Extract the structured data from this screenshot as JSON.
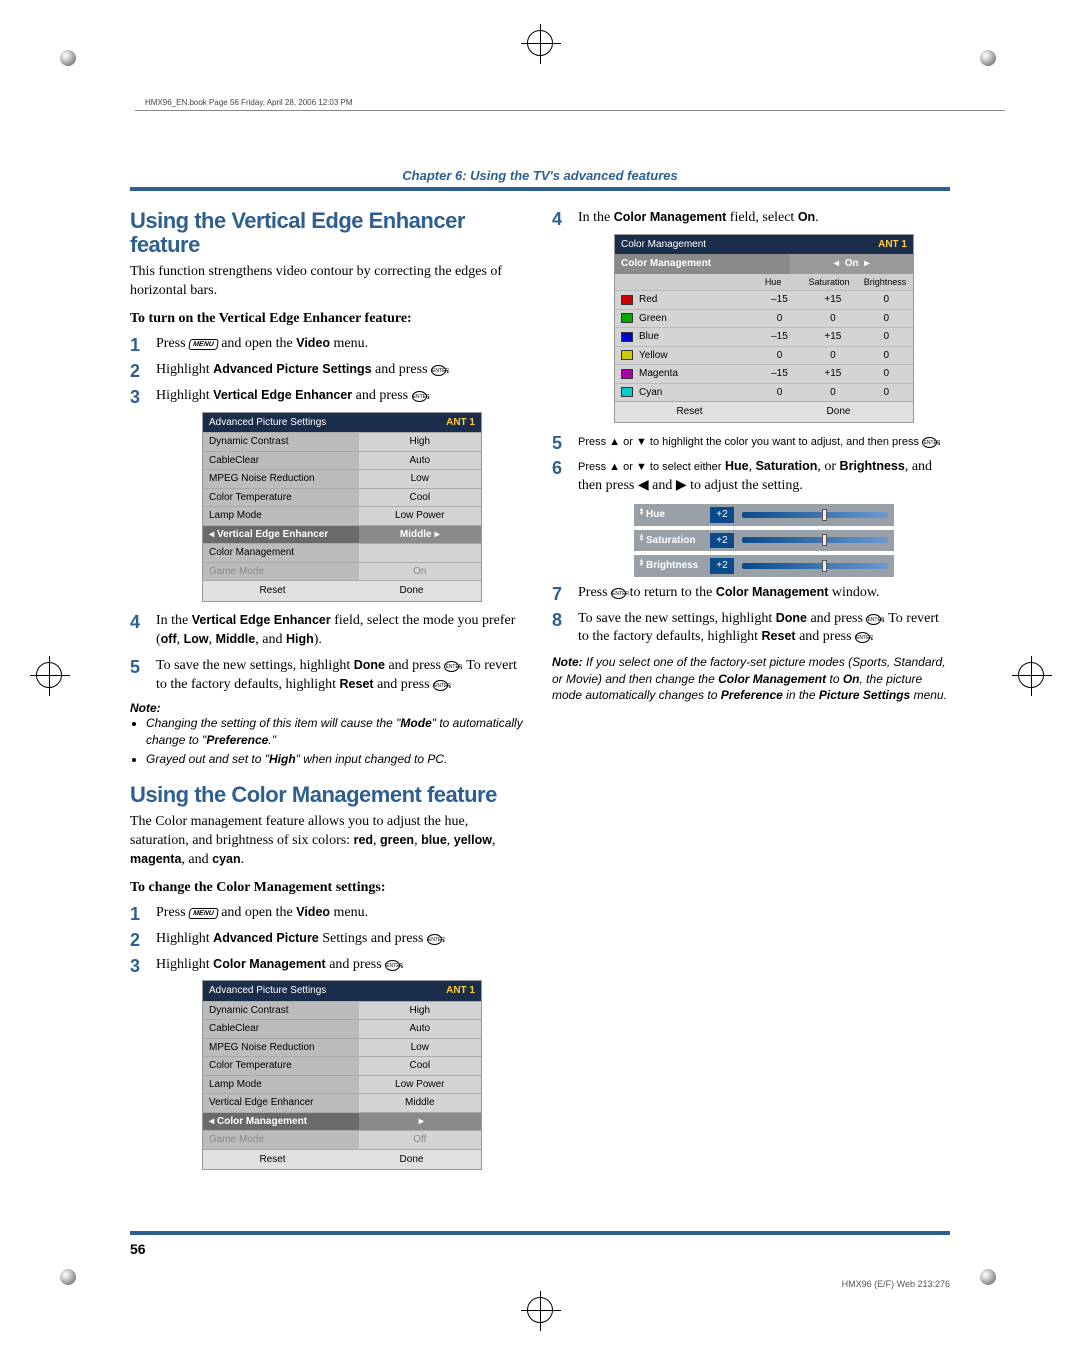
{
  "header_bar": "HMX96_EN.book  Page 56  Friday, April 28, 2006  12:03 PM",
  "chapter": "Chapter 6: Using the TV's advanced features",
  "left": {
    "h1": "Using the Vertical Edge Enhancer feature",
    "intro": "This function strengthens video contour by correcting the edges of horizontal bars.",
    "sub1": "To turn on the Vertical Edge Enhancer feature:",
    "s1a": "Press",
    "s1b": "and open the",
    "s1c": "Video",
    "s1d": "menu.",
    "s2a": "Highlight",
    "s2b": "Advanced Picture Settings",
    "s2c": "and press",
    "s3a": "Highlight",
    "s3b": "Vertical Edge Enhancer",
    "s3c": "and press",
    "panel1": {
      "title": "Advanced Picture Settings",
      "ant": "ANT 1",
      "rows": [
        {
          "l": "Dynamic Contrast",
          "v": "High"
        },
        {
          "l": "CableClear",
          "v": "Auto"
        },
        {
          "l": "MPEG Noise Reduction",
          "v": "Low"
        },
        {
          "l": "Color Temperature",
          "v": "Cool"
        },
        {
          "l": "Lamp Mode",
          "v": "Low Power"
        },
        {
          "l": "Vertical Edge Enhancer",
          "v": "Middle",
          "sel": true
        },
        {
          "l": "Color Management",
          "v": ""
        },
        {
          "l": "Game Mode",
          "v": "On",
          "dim": true
        }
      ],
      "reset": "Reset",
      "done": "Done"
    },
    "s4a": "In the",
    "s4b": "Vertical Edge Enhancer",
    "s4c": "field, select the mode you prefer (",
    "s4d": "off",
    "s4e": ", ",
    "s4f": "Low",
    "s4g": ", ",
    "s4h": "Middle",
    "s4i": ", and ",
    "s4j": "High",
    "s4k": ").",
    "s5a": "To save the new settings, highlight",
    "s5b": "Done",
    "s5c": "and press",
    "s5d": ". To revert to the factory defaults, highlight",
    "s5e": "Reset",
    "s5f": "and press",
    "note": "Note:",
    "n1a": "Changing the setting of this item will cause the \"",
    "n1b": "Mode",
    "n1c": "\" to automatically change to \"",
    "n1d": "Preference",
    "n1e": ".\"",
    "n2a": "Grayed out and set to \"",
    "n2b": "High",
    "n2c": "\" when input changed to PC.",
    "h2": "Using the Color Management feature",
    "intro2a": "The Color management feature allows you to adjust the hue, saturation, and brightness of six colors: ",
    "intro2b": "red",
    "intro2c": ", ",
    "intro2d": "green",
    "intro2e": ", ",
    "intro2f": "blue",
    "intro2g": ", ",
    "intro2h": "yellow",
    "intro2i": ", ",
    "intro2j": "magenta",
    "intro2k": ", and ",
    "intro2l": "cyan",
    "intro2m": ".",
    "sub2": "To change the Color Management settings:",
    "ss1a": "Press",
    "ss1b": "and open the",
    "ss1c": "Video",
    "ss1d": "menu.",
    "ss2a": "Highlight",
    "ss2b": "Advanced Picture",
    "ss2c": "Settings and press",
    "ss3a": "Highlight",
    "ss3b": "Color Management",
    "ss3c": "and press",
    "panel2": {
      "title": "Advanced Picture Settings",
      "ant": "ANT 1",
      "rows": [
        {
          "l": "Dynamic Contrast",
          "v": "High"
        },
        {
          "l": "CableClear",
          "v": "Auto"
        },
        {
          "l": "MPEG Noise Reduction",
          "v": "Low"
        },
        {
          "l": "Color Temperature",
          "v": "Cool"
        },
        {
          "l": "Lamp Mode",
          "v": "Low Power"
        },
        {
          "l": "Vertical Edge Enhancer",
          "v": "Middle"
        },
        {
          "l": "Color Management",
          "v": "",
          "sel": true
        },
        {
          "l": "Game Mode",
          "v": "Off",
          "dim": true
        }
      ],
      "reset": "Reset",
      "done": "Done"
    }
  },
  "right": {
    "s4a": "In the",
    "s4b": "Color Management",
    "s4c": "field, select",
    "s4d": "On",
    "s4e": ".",
    "cm": {
      "title": "Color Management",
      "ant": "ANT 1",
      "sub_l": "Color Management",
      "sub_r": "On",
      "th": [
        "Hue",
        "Saturation",
        "Brightness"
      ],
      "rows": [
        {
          "c": "#c00",
          "n": "Red",
          "h": "–15",
          "s": "+15",
          "b": "0"
        },
        {
          "c": "#0a0",
          "n": "Green",
          "h": "0",
          "s": "0",
          "b": "0"
        },
        {
          "c": "#00c",
          "n": "Blue",
          "h": "–15",
          "s": "+15",
          "b": "0"
        },
        {
          "c": "#cc0",
          "n": "Yellow",
          "h": "0",
          "s": "0",
          "b": "0"
        },
        {
          "c": "#a0a",
          "n": "Magenta",
          "h": "–15",
          "s": "+15",
          "b": "0"
        },
        {
          "c": "#0cc",
          "n": "Cyan",
          "h": "0",
          "s": "0",
          "b": "0"
        }
      ],
      "reset": "Reset",
      "done": "Done"
    },
    "s5a": "Press ▲ or ▼ to highlight the color you want to adjust, and then press",
    "s6a": "Press ▲ or ▼ to select either",
    "s6b": "Hue",
    "s6c": ",",
    "s6d": "Saturation",
    "s6e": ", or",
    "s6f": "Brightness",
    "s6g": ", and then press ◀ and ▶ to adjust the setting.",
    "sliders": [
      {
        "l": "Hue",
        "v": "+2",
        "p": 55
      },
      {
        "l": "Saturation",
        "v": "+2",
        "p": 55
      },
      {
        "l": "Brightness",
        "v": "+2",
        "p": 55
      }
    ],
    "s7a": "Press",
    "s7b": "to return to the",
    "s7c": "Color Management",
    "s7d": "window.",
    "s8a": "To save the new settings, highlight",
    "s8b": "Done",
    "s8c": "and press",
    "s8d": ". To revert to the factory defaults, highlight",
    "s8e": "Reset",
    "s8f": "and press",
    "noteR": "Note:",
    "nr1": "If you select one of the factory-set picture modes (Sports, Standard, or Movie) and then change the",
    "nr2": "Color Management",
    "nr3": "to",
    "nr4": "On",
    "nr5": ", the picture mode automatically changes to",
    "nr6": "Preference",
    "nr7": "in the",
    "nr8": "Picture Settings",
    "nr9": "menu."
  },
  "page_num": "56",
  "footer_code": "HMX96 (E/F) Web 213:276",
  "menu_label": "MENU",
  "enter_label": "ENTER"
}
